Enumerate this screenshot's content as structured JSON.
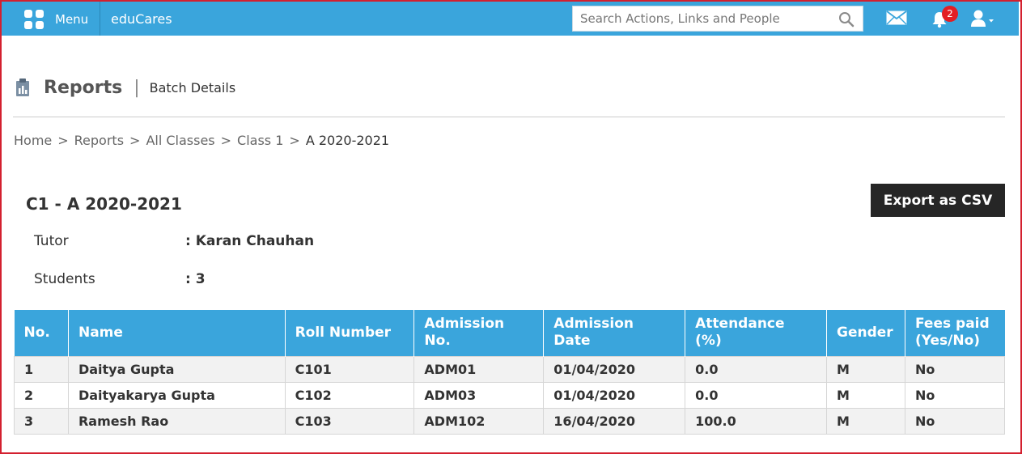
{
  "topbar": {
    "menu_label": "Menu",
    "brand": "eduCares",
    "search_placeholder": "Search Actions, Links and People",
    "notification_count": "2",
    "colors": {
      "bar": "#3aa5dc",
      "badge": "#e31e24"
    },
    "icons": [
      "menu-grid-icon",
      "search-icon",
      "mail-icon",
      "bell-icon",
      "user-icon",
      "caret-down-icon"
    ]
  },
  "header": {
    "title": "Reports",
    "subtitle": "Batch Details",
    "icon": "clipboard-icon"
  },
  "breadcrumb": {
    "items": [
      "Home",
      "Reports",
      "All Classes",
      "Class 1",
      "A 2020-2021"
    ],
    "separator": ">"
  },
  "batch": {
    "title": "C1 - A 2020-2021",
    "export_label": "Export as CSV",
    "tutor_label": "Tutor",
    "tutor_value": ": Karan Chauhan",
    "students_label": "Students",
    "students_value": ": 3"
  },
  "table": {
    "columns": [
      {
        "line1": "No.",
        "line2": ""
      },
      {
        "line1": "Name",
        "line2": ""
      },
      {
        "line1": "Roll Number",
        "line2": ""
      },
      {
        "line1": "Admission",
        "line2": "No."
      },
      {
        "line1": "Admission Date",
        "line2": ""
      },
      {
        "line1": "Attendance",
        "line2": "(%)"
      },
      {
        "line1": "Gender",
        "line2": ""
      },
      {
        "line1": "Fees paid",
        "line2": "(Yes/No)"
      }
    ],
    "rows": [
      [
        "1",
        "Daitya Gupta",
        "C101",
        "ADM01",
        "01/04/2020",
        "0.0",
        "M",
        "No"
      ],
      [
        "2",
        "Daityakarya Gupta",
        "C102",
        "ADM03",
        "01/04/2020",
        "0.0",
        "M",
        "No"
      ],
      [
        "3",
        "Ramesh Rao",
        "C103",
        "ADM102",
        "16/04/2020",
        "100.0",
        "M",
        "No"
      ]
    ]
  }
}
